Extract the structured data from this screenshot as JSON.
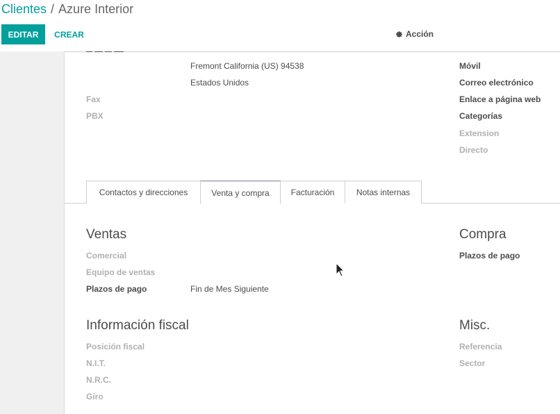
{
  "breadcrumb": {
    "parent": "Clientes",
    "separator": "/",
    "current": "Azure Interior"
  },
  "toolbar": {
    "edit_label": "EDITAR",
    "create_label": "CREAR",
    "action_label": "Acción"
  },
  "address": {
    "line_city": "Fremont  California (US)  94538",
    "line_country": "Estados Unidos",
    "fax_label": "Fax",
    "pbx_label": "PBX"
  },
  "right_fields": {
    "movil": "Móvil",
    "email": "Correo electrónico",
    "web": "Enlace a página web",
    "categorias": "Categorías",
    "extension": "Extension",
    "directo": "Directo"
  },
  "tabs": [
    {
      "label": "Contactos y direcciones"
    },
    {
      "label": "Venta y compra",
      "active": true
    },
    {
      "label": "Facturación"
    },
    {
      "label": "Notas internas"
    }
  ],
  "ventas": {
    "title": "Ventas",
    "comercial": "Comercial",
    "equipo": "Equipo de ventas",
    "plazos_label": "Plazos de pago",
    "plazos_value": "Fin de Mes Siguiente"
  },
  "compra": {
    "title": "Compra",
    "plazos_label": "Plazos de pago"
  },
  "fiscal": {
    "title": "Información fiscal",
    "posicion": "Posición fiscal",
    "nit": "N.I.T.",
    "nrc": "N.R.C.",
    "giro": "Giro"
  },
  "misc": {
    "title": "Misc.",
    "referencia": "Referencia",
    "sector": "Sector"
  },
  "colors": {
    "accent": "#00a09d",
    "tab_active_border": "#7c7bad"
  }
}
